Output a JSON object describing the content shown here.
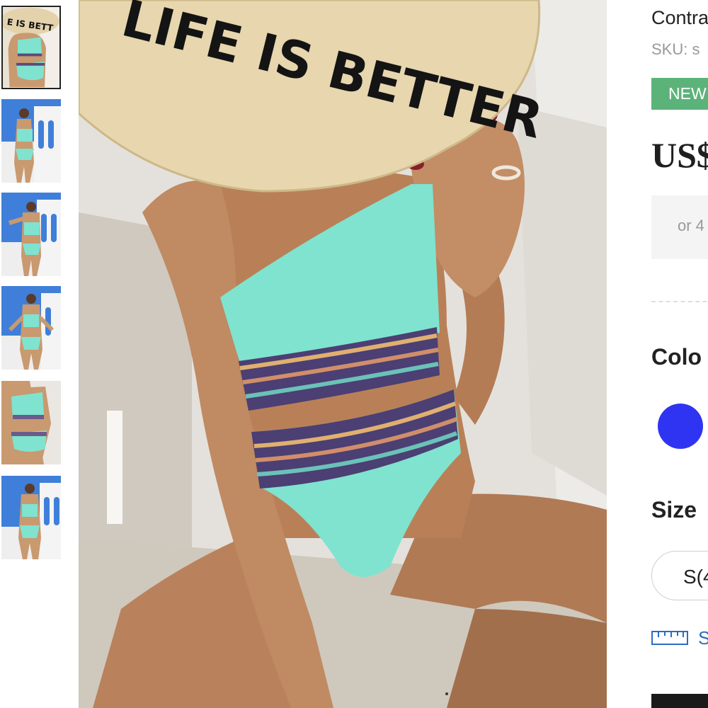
{
  "gallery": {
    "thumbnails": [
      {
        "label": "thumbnail 1",
        "active": true
      },
      {
        "label": "thumbnail 2",
        "active": false
      },
      {
        "label": "thumbnail 3",
        "active": false
      },
      {
        "label": "thumbnail 4",
        "active": false
      },
      {
        "label": "thumbnail 5",
        "active": false
      },
      {
        "label": "thumbnail 6",
        "active": false
      }
    ],
    "hat_text": "LIFE IS BETTER",
    "thumb_hat_text": "E IS BETT"
  },
  "product": {
    "title": "Contra",
    "sku": "SKU: s",
    "badge": "NEW",
    "price": "US$",
    "installment": "or 4",
    "color_label": "Colo",
    "swatch_color": "#2f34f2",
    "size_label": "Size",
    "size_option": "S(4",
    "size_guide": "S"
  },
  "colors": {
    "badge_bg": "#5cb37a",
    "bikini": "#7fe3cf",
    "link": "#2b6cc4"
  }
}
